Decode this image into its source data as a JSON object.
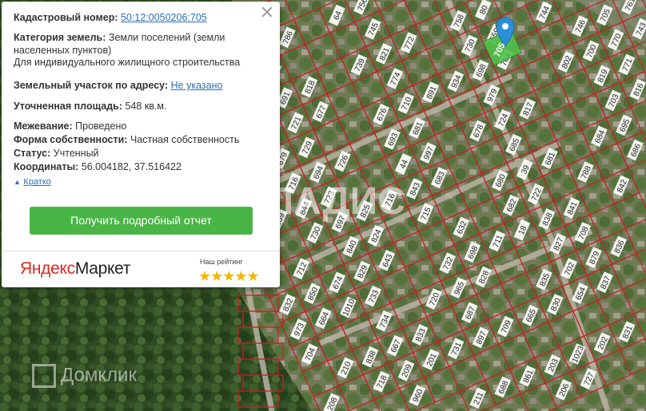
{
  "popup": {
    "cadastral_label": "Кадастровый номер:",
    "cadastral_value": "50:12:0050206:705",
    "category_label": "Категория земель:",
    "category_value": "Земли поселений (земли",
    "category_value_2": "населенных пунктов)",
    "category_use": "Для индивидуального жилищного строительства",
    "address_label": "Земельный участок по адресу:",
    "address_value": "Не указано",
    "area_label": "Уточненная площадь:",
    "area_value": "548 кв.м.",
    "survey_label": "Межевание:",
    "survey_value": "Проведено",
    "ownership_label": "Форма собственности:",
    "ownership_value": "Частная собственность",
    "status_label": "Статус:",
    "status_value": "Учтенный",
    "coords_label": "Координаты:",
    "coords_value": "56.004182, 37.516422",
    "collapse_label": "Кратко",
    "report_button": "Получить подробный отчет",
    "logo_part1": "Яндекс",
    "logo_part2": "Маркет",
    "rating_label": "Наш рейтинг",
    "rating_stars": "★★★★★",
    "rating_value": 5
  },
  "watermarks": {
    "center": "ВЛАДИС",
    "bottom_left": "Домклик"
  },
  "map": {
    "parcel_labels": [
      "761",
      "756",
      "80",
      "744",
      "705",
      "64",
      "758",
      "755",
      "746",
      "743",
      "745",
      "56592",
      "786",
      "770",
      "772",
      "730",
      "699",
      "700",
      "821",
      "764",
      "802",
      "771",
      "739",
      "698",
      "820",
      "819",
      "774",
      "934",
      "689",
      "818",
      "816",
      "891",
      "979",
      "691",
      "703",
      "710",
      "817",
      "690",
      "677",
      "676",
      "724",
      "721",
      "695",
      "681",
      "678",
      "78",
      "684",
      "693",
      "685",
      "675",
      "729",
      "686",
      "997",
      "681",
      "679",
      "726",
      "44",
      "39",
      "788",
      "694",
      "683",
      "680",
      "716",
      "842",
      "843",
      "722",
      "774",
      "723",
      "716",
      "682",
      "841",
      "844",
      "825",
      "715",
      "838",
      "839",
      "697",
      "632",
      "18",
      "708",
      "730",
      "824",
      "711",
      "827",
      "836",
      "840",
      "698",
      "888",
      "879",
      "643",
      "732",
      "702",
      "712",
      "829",
      "828",
      "835",
      "837",
      "674",
      "965",
      "654",
      "850",
      "733",
      "720",
      "830",
      "832",
      "1010",
      "687",
      "665",
      "664",
      "734",
      "709",
      "973",
      "831",
      "833",
      "897",
      "202",
      "667",
      "731",
      "1023",
      "704",
      "838",
      "201",
      "203",
      "210",
      "209",
      "861",
      "727",
      "718",
      "688",
      "206",
      "960",
      "211",
      "208"
    ],
    "selected_parcel_label": "705",
    "pin_color": "#2a8fd6",
    "selected_color": "#4fc24a",
    "parcel_border_color": "#c8202a"
  }
}
